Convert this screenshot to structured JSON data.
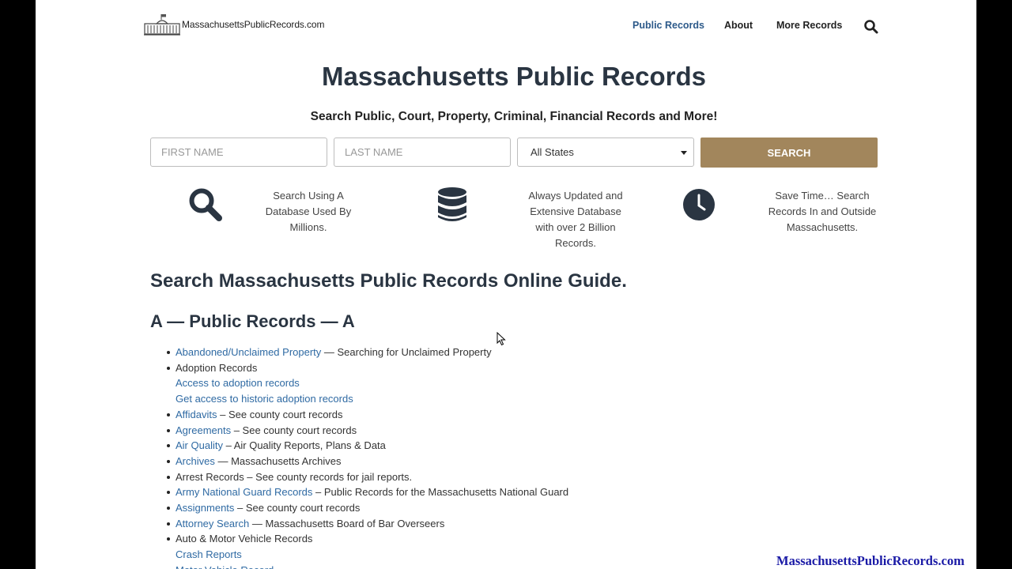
{
  "header": {
    "logo_text": "MassachusettsPublicRecords.com",
    "nav": [
      {
        "label": "Public Records"
      },
      {
        "label": "About"
      },
      {
        "label": "More Records"
      }
    ]
  },
  "hero": {
    "title": "Massachusetts Public Records",
    "subtitle": "Search Public, Court, Property, Criminal, Financial Records and More!"
  },
  "search_form": {
    "first_name_placeholder": "FIRST NAME",
    "last_name_placeholder": "LAST NAME",
    "state_selected": "All States",
    "button_label": "SEARCH"
  },
  "features": [
    {
      "icon": "magnifier-icon",
      "lines": [
        "Search Using A",
        "Database Used By",
        "Millions."
      ]
    },
    {
      "icon": "database-icon",
      "lines": [
        "Always Updated and",
        "Extensive Database",
        "with over 2 Billion",
        "Records."
      ]
    },
    {
      "icon": "clock-icon",
      "lines": [
        "Save Time… Search",
        "Records In and Outside",
        "Massachusetts."
      ]
    }
  ],
  "guide": {
    "title": "Search Massachusetts Public Records Online Guide.",
    "section_title": "A — Public Records — A",
    "items": [
      {
        "bullet": true,
        "link": "Abandoned/Unclaimed Property",
        "text": " — Searching for Unclaimed Property"
      },
      {
        "bullet": true,
        "link": "",
        "text": "Adoption Records"
      },
      {
        "bullet": false,
        "link": "Access to adoption records",
        "text": ""
      },
      {
        "bullet": false,
        "link": "Get access to historic adoption records",
        "text": ""
      },
      {
        "bullet": true,
        "link": "Affidavits",
        "text": " – See county court records"
      },
      {
        "bullet": true,
        "link": "Agreements",
        "text": " – See county court records"
      },
      {
        "bullet": true,
        "link": "Air Quality",
        "text": " – Air Quality Reports, Plans & Data"
      },
      {
        "bullet": true,
        "link": "Archives",
        "text": " — Massachusetts Archives"
      },
      {
        "bullet": true,
        "link": "",
        "text": "Arrest Records – See county records for jail reports."
      },
      {
        "bullet": true,
        "link": "Army National Guard Records",
        "text": " – Public Records for the Massachusetts National Guard"
      },
      {
        "bullet": true,
        "link": "Assignments",
        "text": " – See county court records"
      },
      {
        "bullet": true,
        "link": "Attorney Search",
        "text": " — Massachusetts Board of Bar Overseers"
      },
      {
        "bullet": true,
        "link": "",
        "text": "Auto & Motor Vehicle Records"
      },
      {
        "bullet": false,
        "link": "Crash Reports",
        "text": ""
      },
      {
        "bullet": false,
        "link": "Motor Vehicle Record",
        "text": ""
      }
    ]
  },
  "watermark": "MassachusettsPublicRecords.com",
  "colors": {
    "accent_button": "#a2865c",
    "link": "#2f6aa3",
    "nav_active": "#2d5a8a",
    "heading": "#2a3542",
    "watermark": "#1a1aa6"
  }
}
